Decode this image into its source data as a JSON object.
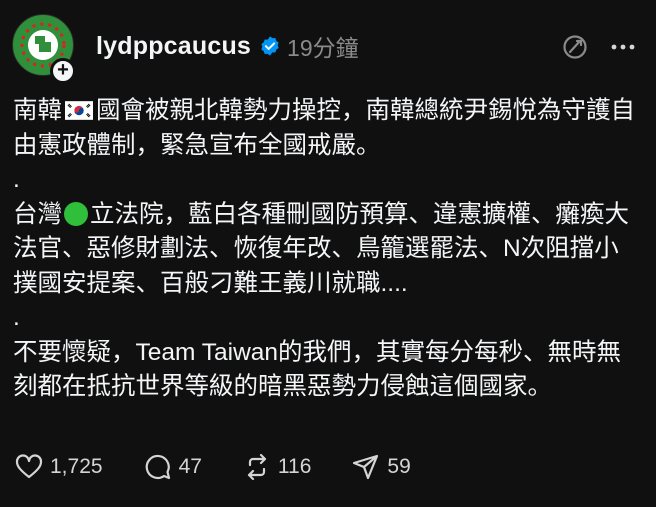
{
  "post": {
    "username": "lydppcaucus",
    "time": "19分鐘",
    "icons": {
      "avatar": "party-logo-avatar",
      "follow": "plus-icon",
      "verified": "verified-badge-icon",
      "translate": "translate-icon",
      "more": "more-icon"
    },
    "paragraph1_a": "南韓",
    "paragraph1_flag": "south-korea-flag-emoji",
    "paragraph1_b": "國會被親北韓勢力操控，南韓總統尹錫悅為守護自由憲政體制，緊急宣布全國戒嚴。",
    "separator1": ".",
    "paragraph2_a": "台灣",
    "paragraph2_emoji": "green-circle-emoji",
    "paragraph2_b": "立法院，藍白各種刪國防預算、違憲擴權、癱瘓大法官、惡修財劃法、恢復年改、鳥籠選罷法、N次阻擋小撲國安提案、百般刁難王義川就職....",
    "separator2": ".",
    "paragraph3": "不要懷疑，Team Taiwan的我們，其實每分每秒、無時無刻都在抵抗世界等級的暗黑惡勢力侵蝕這個國家。",
    "colors": {
      "background": "#101010",
      "text": "#f3f5f7",
      "muted": "#8a8a8a",
      "verified": "#0095f6"
    }
  },
  "actions": {
    "like_count": "1,725",
    "comment_count": "47",
    "repost_count": "116",
    "share_count": "59",
    "icons": [
      "heart-icon",
      "comment-icon",
      "repost-icon",
      "share-icon"
    ]
  }
}
